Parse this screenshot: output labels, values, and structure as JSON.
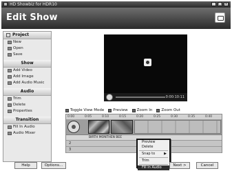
{
  "window": {
    "title": "HD Showbiz for HDR10",
    "controls": [
      "_",
      "□",
      "×"
    ]
  },
  "header": {
    "title": "Edit Show"
  },
  "sidebar": {
    "sections": [
      {
        "title": "Project",
        "items": [
          {
            "label": "New"
          },
          {
            "label": "Open"
          },
          {
            "label": "Save"
          }
        ]
      },
      {
        "title": "Show",
        "items": [
          {
            "label": "Add Video"
          },
          {
            "label": "Add Image"
          },
          {
            "label": "Add Audio Music"
          }
        ]
      },
      {
        "title": "Audio",
        "items": [
          {
            "label": "Trim"
          },
          {
            "label": "Delete"
          },
          {
            "label": "Properties"
          }
        ]
      },
      {
        "title": "Transition",
        "items": [
          {
            "label": "Fill In Audio"
          },
          {
            "label": "Audio Mixer"
          }
        ]
      }
    ]
  },
  "preview": {
    "time": "0:00:10:11"
  },
  "toolbar": {
    "items": [
      {
        "label": "Toggle View Mode"
      },
      {
        "label": "Preview"
      },
      {
        "label": "Zoom In"
      },
      {
        "label": "Zoom Out"
      }
    ]
  },
  "timeline": {
    "ruler": [
      "0:00",
      "0:05",
      "0:10",
      "0:15",
      "0:20",
      "0:25",
      "0:30",
      "0:35",
      "0:40",
      "0:45"
    ],
    "clip_label": "BIRTH MONTHEN BEE",
    "rows": [
      "1",
      "2",
      "3"
    ]
  },
  "context_menu": {
    "items": [
      {
        "label": "Preview",
        "selected": false
      },
      {
        "label": "Delete",
        "selected": false
      },
      {
        "label": "Snap to",
        "selected": false,
        "arrow": "▶"
      },
      {
        "label": "Trim",
        "selected": false
      },
      {
        "label": "Fill In Audio",
        "selected": true
      }
    ]
  },
  "buttons": {
    "help": "Help",
    "options": "Options...",
    "next": "Next >",
    "cancel": "Cancel"
  }
}
